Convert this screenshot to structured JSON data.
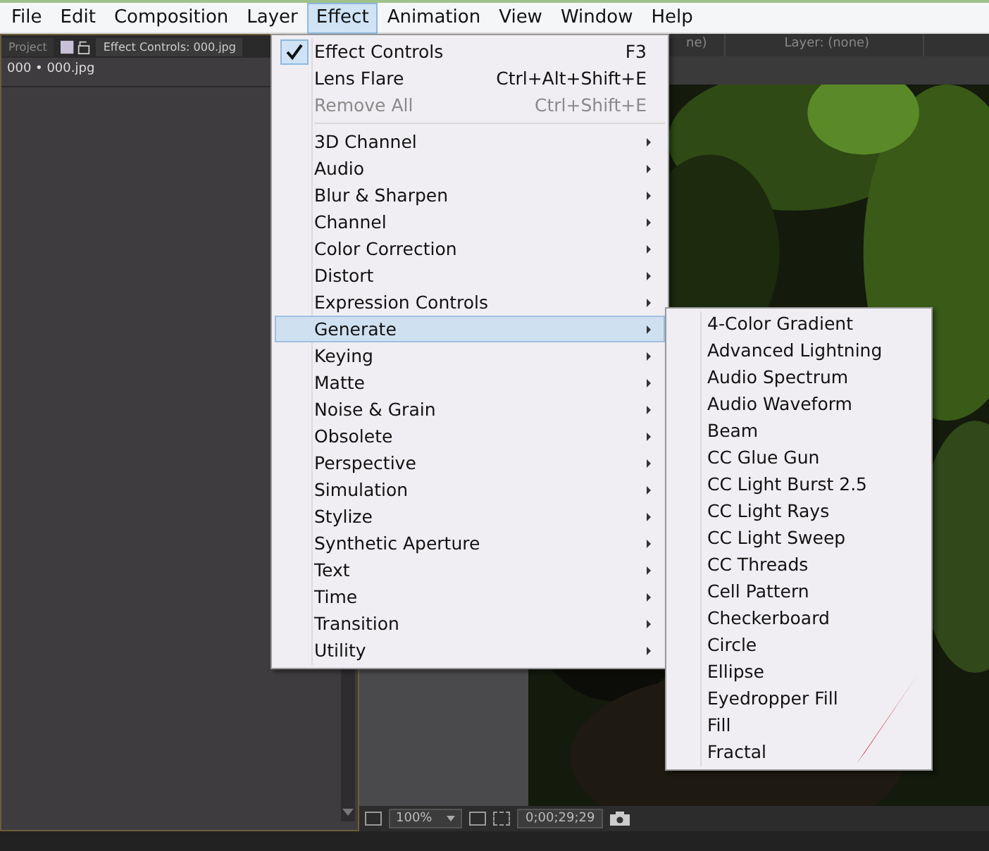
{
  "menubar": [
    {
      "label": "File",
      "selected": false
    },
    {
      "label": "Edit",
      "selected": false
    },
    {
      "label": "Composition",
      "selected": false
    },
    {
      "label": "Layer",
      "selected": false
    },
    {
      "label": "Effect",
      "selected": true
    },
    {
      "label": "Animation",
      "selected": false
    },
    {
      "label": "View",
      "selected": false
    },
    {
      "label": "Window",
      "selected": false
    },
    {
      "label": "Help",
      "selected": false
    }
  ],
  "left_panel": {
    "tabs": [
      {
        "label": "Project",
        "selected": false
      },
      {
        "label": "Effect Controls: 000.jpg",
        "selected": true
      }
    ],
    "header": "000 • 000.jpg"
  },
  "viewer": {
    "tabs": [
      {
        "label": "ne)"
      },
      {
        "label": "Layer: (none)"
      }
    ],
    "toolbar": {
      "zoom": "100%",
      "timecode": "0;00;29;29"
    }
  },
  "effect_menu": [
    {
      "kind": "command",
      "label": "Effect Controls",
      "shortcut": "F3",
      "checked": true,
      "disabled": false,
      "selected": false
    },
    {
      "kind": "command",
      "label": "Lens Flare",
      "shortcut": "Ctrl+Alt+Shift+E",
      "checked": false,
      "disabled": false,
      "selected": false
    },
    {
      "kind": "command",
      "label": "Remove All",
      "shortcut": "Ctrl+Shift+E",
      "checked": false,
      "disabled": true,
      "selected": false
    },
    {
      "kind": "separator"
    },
    {
      "kind": "submenu",
      "label": "3D Channel",
      "selected": false
    },
    {
      "kind": "submenu",
      "label": "Audio",
      "selected": false
    },
    {
      "kind": "submenu",
      "label": "Blur & Sharpen",
      "selected": false
    },
    {
      "kind": "submenu",
      "label": "Channel",
      "selected": false
    },
    {
      "kind": "submenu",
      "label": "Color Correction",
      "selected": false
    },
    {
      "kind": "submenu",
      "label": "Distort",
      "selected": false
    },
    {
      "kind": "submenu",
      "label": "Expression Controls",
      "selected": false
    },
    {
      "kind": "submenu",
      "label": "Generate",
      "selected": true
    },
    {
      "kind": "submenu",
      "label": "Keying",
      "selected": false
    },
    {
      "kind": "submenu",
      "label": "Matte",
      "selected": false
    },
    {
      "kind": "submenu",
      "label": "Noise & Grain",
      "selected": false
    },
    {
      "kind": "submenu",
      "label": "Obsolete",
      "selected": false
    },
    {
      "kind": "submenu",
      "label": "Perspective",
      "selected": false
    },
    {
      "kind": "submenu",
      "label": "Simulation",
      "selected": false
    },
    {
      "kind": "submenu",
      "label": "Stylize",
      "selected": false
    },
    {
      "kind": "submenu",
      "label": "Synthetic Aperture",
      "selected": false
    },
    {
      "kind": "submenu",
      "label": "Text",
      "selected": false
    },
    {
      "kind": "submenu",
      "label": "Time",
      "selected": false
    },
    {
      "kind": "submenu",
      "label": "Transition",
      "selected": false
    },
    {
      "kind": "submenu",
      "label": "Utility",
      "selected": false
    }
  ],
  "generate_submenu": [
    "4-Color Gradient",
    "Advanced Lightning",
    "Audio Spectrum",
    "Audio Waveform",
    "Beam",
    "CC Glue Gun",
    "CC Light Burst 2.5",
    "CC Light Rays",
    "CC Light Sweep",
    "CC Threads",
    "Cell Pattern",
    "Checkerboard",
    "Circle",
    "Ellipse",
    "Eyedropper Fill",
    "Fill",
    "Fractal"
  ]
}
